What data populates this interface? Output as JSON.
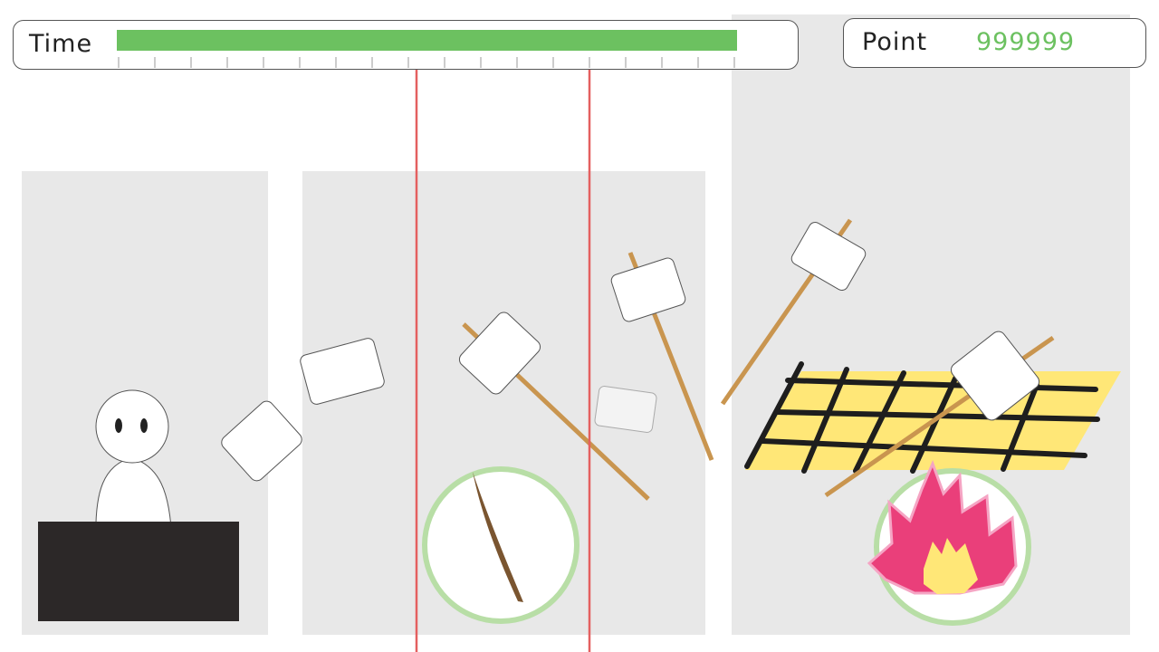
{
  "hud": {
    "time_label": "Time",
    "time_remaining": 1.0,
    "point_label": "Point",
    "point_value": "999999"
  },
  "colors": {
    "time_bar": "#6cc160",
    "score_text": "#6cc160",
    "judge_line": "#e46060",
    "target_ring": "#b8dea6",
    "stick": "#c9954f",
    "grill": "#ffe777",
    "flame": "#ea3f7a"
  },
  "icons": {
    "player": "person-icon",
    "table": "counter-block",
    "marshmallow": "marshmallow-icon",
    "skewer": "skewer-icon",
    "grill": "grill-net-icon",
    "fire": "fire-icon",
    "stick_target": "stick-target-icon"
  }
}
